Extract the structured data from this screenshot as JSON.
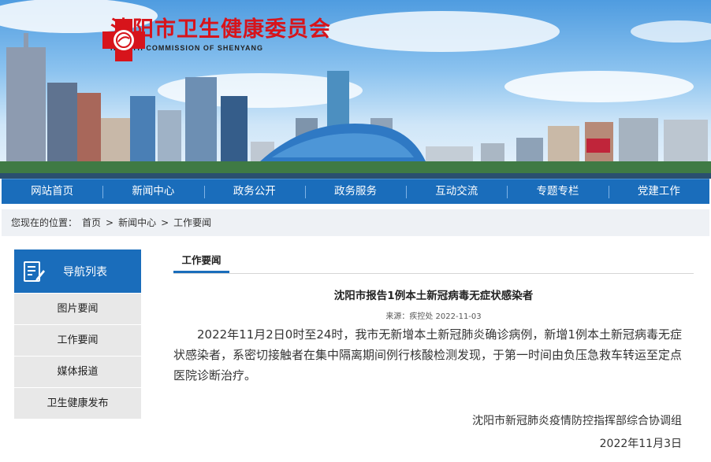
{
  "header": {
    "title_cn": "沈阳市卫生健康委员会",
    "title_en": "HEALTH COMMISSION OF SHENYANG"
  },
  "nav": {
    "items": [
      "网站首页",
      "新闻中心",
      "政务公开",
      "政务服务",
      "互动交流",
      "专题专栏",
      "党建工作"
    ]
  },
  "breadcrumb": {
    "prefix": "您现在的位置：",
    "items": [
      "首页",
      "新闻中心",
      "工作要闻"
    ],
    "separator": ">"
  },
  "sidebar": {
    "title": "导航列表",
    "items": [
      "图片要闻",
      "工作要闻",
      "媒体报道",
      "卫生健康发布"
    ]
  },
  "main": {
    "tab": "工作要闻",
    "article": {
      "title": "沈阳市报告1例本土新冠病毒无症状感染者",
      "meta": "来源：疾控处  2022-11-03",
      "body": "2022年11月2日0时至24时，我市无新增本土新冠肺炎确诊病例，新增1例本土新冠病毒无症状感染者，系密切接触者在集中隔离期间例行核酸检测发现，于第一时间由负压急救车转运至定点医院诊断治疗。",
      "signature_org": "沈阳市新冠肺炎疫情防控指挥部综合协调组",
      "signature_date": "2022年11月3日"
    }
  },
  "colors": {
    "brand_blue": "#1a6dbb",
    "logo_red": "#d7141b",
    "crumb_bg": "#eef1f5"
  },
  "icons": {
    "logo": "health-cross-logo-icon",
    "sidebar": "document-edit-icon"
  }
}
